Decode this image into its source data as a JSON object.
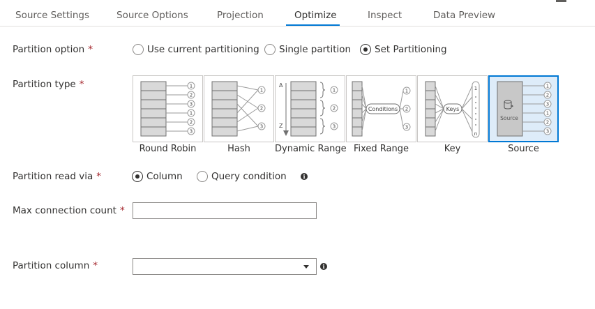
{
  "tabs": [
    {
      "label": "Source Settings"
    },
    {
      "label": "Source Options"
    },
    {
      "label": "Projection"
    },
    {
      "label": "Optimize"
    },
    {
      "label": "Inspect"
    },
    {
      "label": "Data Preview"
    }
  ],
  "active_tab": "Optimize",
  "partition_option": {
    "label": "Partition option",
    "required": "*",
    "options": [
      "Use current partitioning",
      "Single partition",
      "Set Partitioning"
    ],
    "selected": "Set Partitioning"
  },
  "partition_type": {
    "label": "Partition type",
    "required": "*",
    "options": [
      "Round Robin",
      "Hash",
      "Dynamic Range",
      "Fixed Range",
      "Key",
      "Source"
    ],
    "selected": "Source",
    "diagram_text": {
      "range_start": "A",
      "range_end": "Z",
      "conditions": "Conditions",
      "keys": "Keys",
      "source": "Source",
      "n": "n"
    }
  },
  "partition_read_via": {
    "label": "Partition read via",
    "required": "*",
    "options": [
      "Column",
      "Query condition"
    ],
    "selected": "Column"
  },
  "max_connection_count": {
    "label": "Max connection count",
    "required": "*",
    "value": "",
    "placeholder": ""
  },
  "partition_column": {
    "label": "Partition column",
    "required": "*",
    "value": ""
  },
  "colors": {
    "accent": "#0078d4",
    "required": "#a4262c",
    "selected_tile_bg": "#deecf9"
  }
}
